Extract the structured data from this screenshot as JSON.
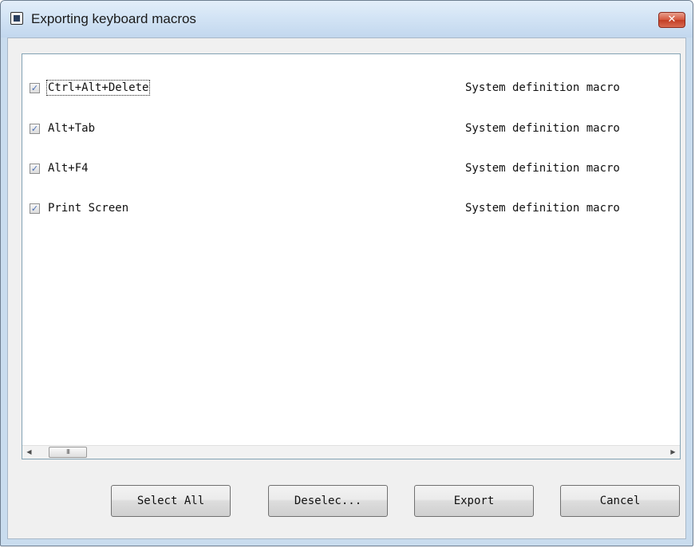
{
  "window": {
    "title": "Exporting keyboard macros",
    "close_glyph": "✕"
  },
  "macro_list": {
    "rows": [
      {
        "checked": true,
        "name": "Ctrl+Alt+Delete",
        "type": "System definition macro"
      },
      {
        "checked": true,
        "name": "Alt+Tab",
        "type": "System definition macro"
      },
      {
        "checked": true,
        "name": "Alt+F4",
        "type": "System definition macro"
      },
      {
        "checked": true,
        "name": "Print Screen",
        "type": "System definition macro"
      }
    ],
    "check_glyph": "✓",
    "scrollbar": {
      "left_arrow": "◀",
      "right_arrow": "▶",
      "thumb_grip": "III"
    }
  },
  "buttons": {
    "select_all": "Select All",
    "deselect": "Deselec...",
    "export": "Export",
    "cancel": "Cancel"
  },
  "colors": {
    "frame": "#c9dcee",
    "close_button": "#d5553c",
    "check_accent": "#4a6fb5"
  },
  "icons": {
    "app": "window-icon",
    "close": "close-icon"
  }
}
